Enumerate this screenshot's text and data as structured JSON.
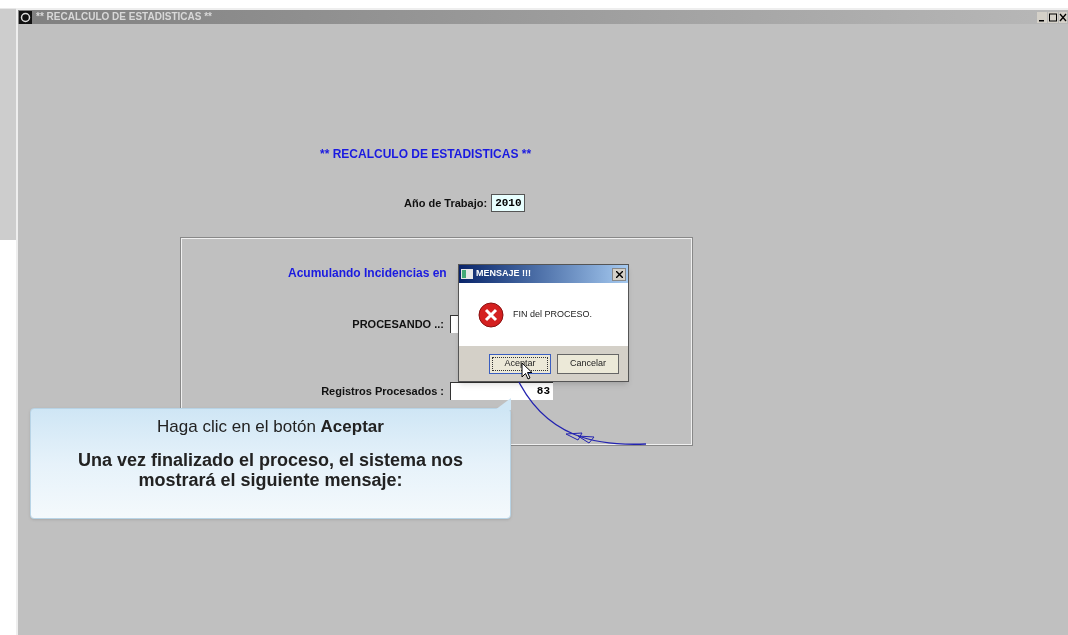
{
  "window": {
    "title": "** RECALCULO DE ESTADISTICAS **"
  },
  "heading": "** RECALCULO DE ESTADISTICAS **",
  "year_field": {
    "label": "Año de Trabajo:",
    "value": "2010"
  },
  "group": {
    "title": "Acumulando Incidencias en",
    "fields": [
      {
        "label": "PROCESANDO ..:"
      },
      {
        "label": "Registros Procesados :",
        "value": "83"
      }
    ]
  },
  "dialog": {
    "title": "MENSAJE !!!",
    "message": "FIN del PROCESO.",
    "buttons": [
      {
        "label": "Aceptar",
        "focused": true
      },
      {
        "label": "Cancelar",
        "focused": false
      }
    ]
  },
  "callout": {
    "lines": [
      "Haga clic en el botón **Aceptar**",
      "Una vez finalizado el proceso, el sistema nos mostrará el siguiente mensaje:"
    ]
  }
}
